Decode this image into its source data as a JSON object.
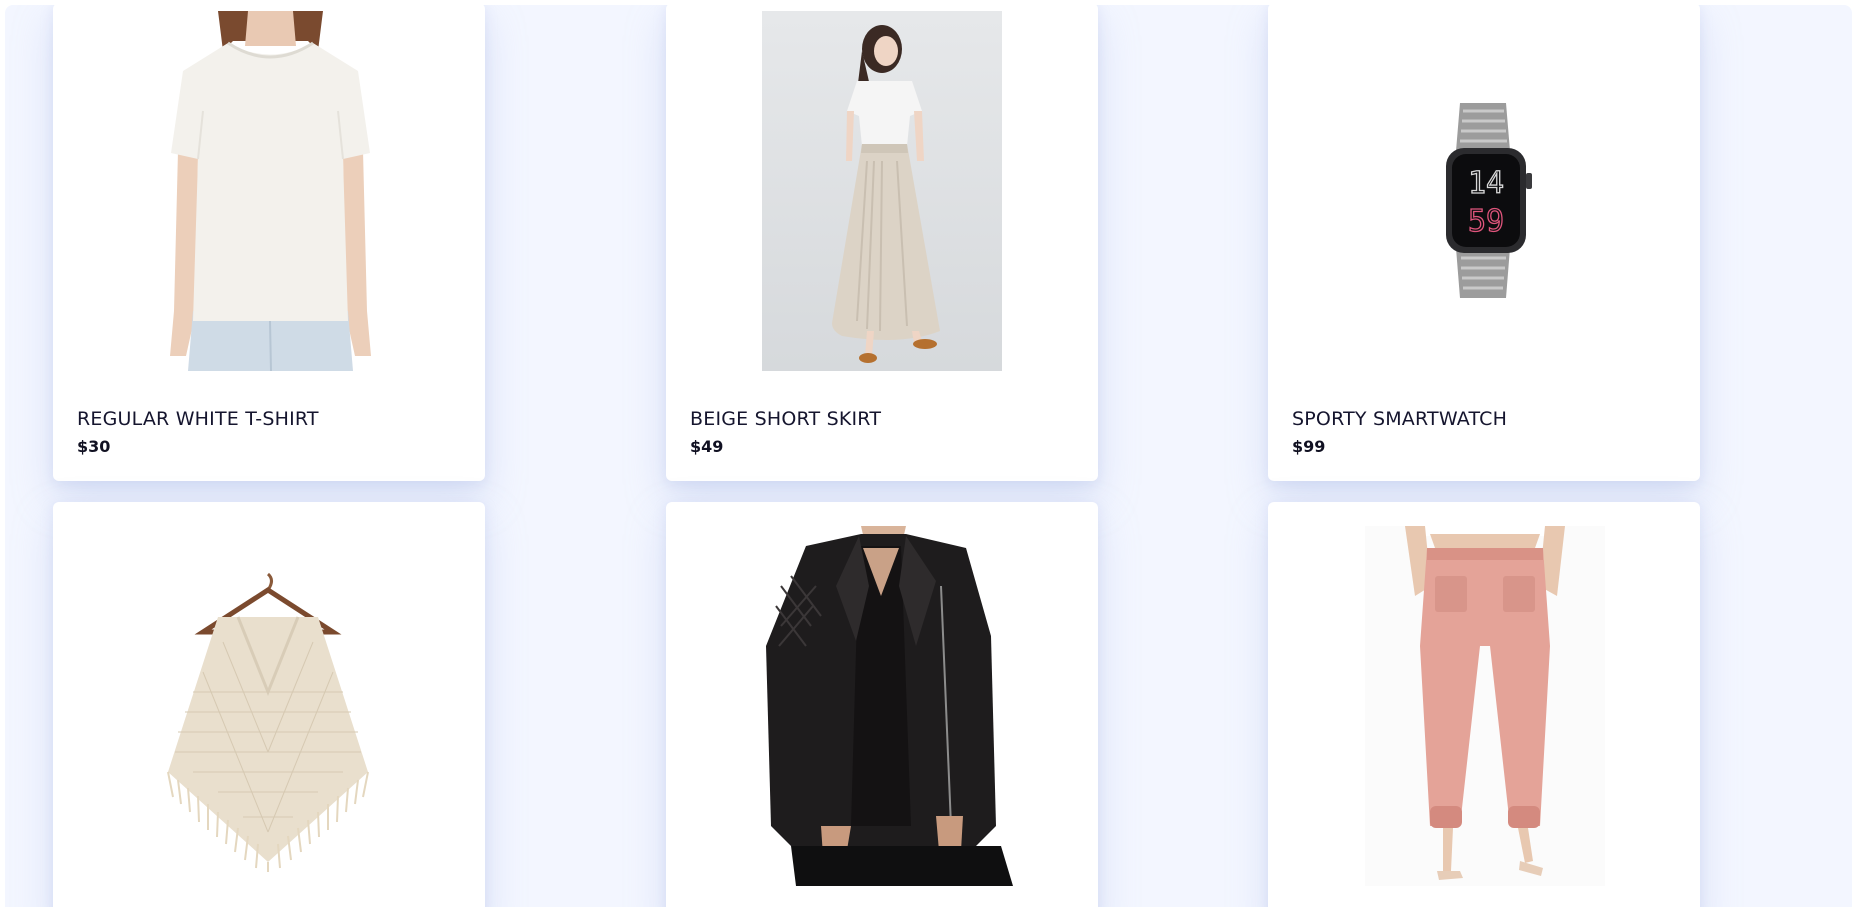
{
  "products": [
    {
      "name": "REGULAR WHITE T-SHIRT",
      "price": "$30",
      "image_icon": "white-tshirt-photo"
    },
    {
      "name": "BEIGE SHORT SKIRT",
      "price": "$49",
      "image_icon": "beige-skirt-photo"
    },
    {
      "name": "SPORTY SMARTWATCH",
      "price": "$99",
      "image_icon": "smartwatch-photo"
    },
    {
      "name": "",
      "price": "",
      "image_icon": "knit-poncho-photo"
    },
    {
      "name": "",
      "price": "",
      "image_icon": "leather-jacket-photo"
    },
    {
      "name": "",
      "price": "",
      "image_icon": "pink-pants-photo"
    }
  ],
  "watch_face": {
    "hours": "14",
    "minutes": "59"
  },
  "colors": {
    "page_background": "#f3f6ff",
    "card_background": "#ffffff",
    "title_text": "#15152e",
    "price_text": "#111122",
    "watch_minutes": "#e0557c"
  }
}
